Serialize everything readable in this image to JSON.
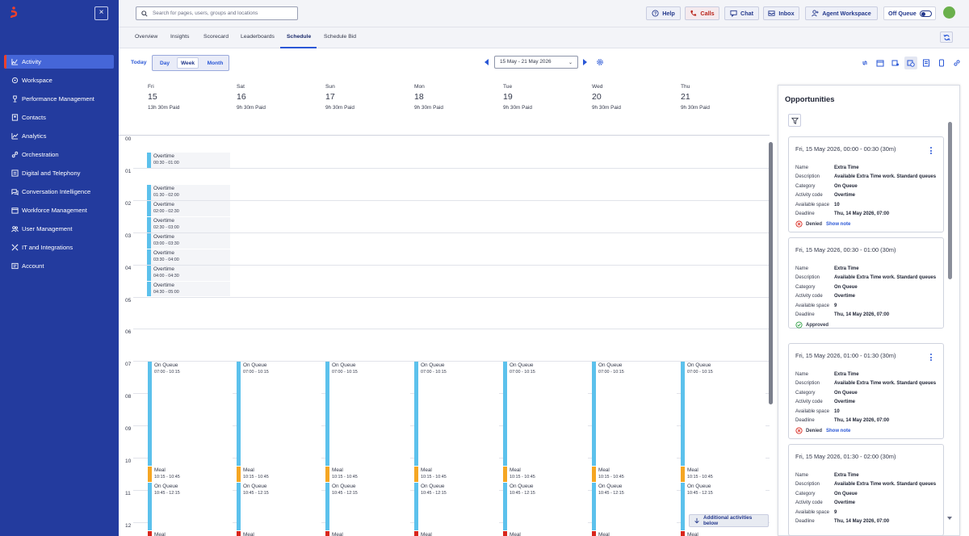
{
  "search": {
    "placeholder": "Search for pages, users, groups and locations"
  },
  "topbar": {
    "help": "Help",
    "calls": "Calls",
    "chat": "Chat",
    "inbox": "Inbox",
    "agent_workspace": "Agent Workspace",
    "off_queue": "Off Queue"
  },
  "sidebar": {
    "items": [
      {
        "label": "Activity",
        "icon": "activity-icon",
        "active": true
      },
      {
        "label": "Workspace",
        "icon": "workspace-icon"
      },
      {
        "label": "Performance Management",
        "icon": "trophy-icon"
      },
      {
        "label": "Contacts",
        "icon": "contacts-icon"
      },
      {
        "label": "Analytics",
        "icon": "analytics-icon"
      },
      {
        "label": "Orchestration",
        "icon": "orchestration-icon"
      },
      {
        "label": "Digital and Telephony",
        "icon": "phone-icon"
      },
      {
        "label": "Conversation Intelligence",
        "icon": "conversation-icon"
      },
      {
        "label": "Workforce Management",
        "icon": "workforce-icon"
      },
      {
        "label": "User Management",
        "icon": "users-icon"
      },
      {
        "label": "IT and Integrations",
        "icon": "tools-icon"
      },
      {
        "label": "Account",
        "icon": "account-icon"
      }
    ]
  },
  "tabs": [
    "Overview",
    "Insights",
    "Scorecard",
    "Leaderboards",
    "Schedule",
    "Schedule Bid"
  ],
  "active_tab": "Schedule",
  "toolbar": {
    "today": "Today",
    "views": [
      "Day",
      "Week",
      "Month"
    ],
    "active_view": "Week",
    "date_range": "15 May - 21 May 2026"
  },
  "days": [
    {
      "name": "Fri",
      "date": "15",
      "paid": "13h 30m Paid"
    },
    {
      "name": "Sat",
      "date": "16",
      "paid": "9h 30m Paid"
    },
    {
      "name": "Sun",
      "date": "17",
      "paid": "9h 30m Paid"
    },
    {
      "name": "Mon",
      "date": "18",
      "paid": "9h 30m Paid"
    },
    {
      "name": "Tue",
      "date": "19",
      "paid": "9h 30m Paid"
    },
    {
      "name": "Wed",
      "date": "20",
      "paid": "9h 30m Paid"
    },
    {
      "name": "Thu",
      "date": "21",
      "paid": "9h 30m Paid"
    }
  ],
  "hours": [
    "00",
    "01",
    "02",
    "03",
    "04",
    "05",
    "06",
    "07",
    "08",
    "09",
    "10",
    "11",
    "12"
  ],
  "overtime": [
    {
      "label": "Overtime",
      "time": "00:30 - 01:00"
    },
    {
      "label": "Overtime",
      "time": "01:30 - 02:00"
    },
    {
      "label": "Overtime",
      "time": "02:00 - 02:30"
    },
    {
      "label": "Overtime",
      "time": "02:30 - 03:00"
    },
    {
      "label": "Overtime",
      "time": "03:00 - 03:30"
    },
    {
      "label": "Overtime",
      "time": "03:30 - 04:00"
    },
    {
      "label": "Overtime",
      "time": "04:00 - 04:30"
    },
    {
      "label": "Overtime",
      "time": "04:30 - 05:00"
    }
  ],
  "daily_activities": [
    {
      "label": "On Queue",
      "time": "07:00 - 10:15",
      "kind": "queue"
    },
    {
      "label": "Meal",
      "time": "10:15 - 10:45",
      "kind": "meal"
    },
    {
      "label": "On Queue",
      "time": "10:45 - 12:15",
      "kind": "queue"
    },
    {
      "label": "Meal",
      "time": "",
      "kind": "break"
    }
  ],
  "additional_activities": "Additional activities below",
  "opportunities": {
    "title": "Opportunities",
    "cards": [
      {
        "title": "Fri, 15 May 2026, 00:00 - 00:30 (30m)",
        "name": "Extra Time",
        "description": "Available Extra Time work. Standard queues",
        "category": "On Queue",
        "activity_code": "Overtime",
        "available_space": "10",
        "deadline": "Thu, 14 May 2026, 07:00",
        "status": "Denied",
        "note": "Show note",
        "menu": true
      },
      {
        "title": "Fri, 15 May 2026, 00:30 - 01:00 (30m)",
        "name": "Extra Time",
        "description": "Available Extra Time work. Standard queues",
        "category": "On Queue",
        "activity_code": "Overtime",
        "available_space": "9",
        "deadline": "Thu, 14 May 2026, 07:00",
        "status": "Approved",
        "note": "",
        "menu": false
      },
      {
        "title": "Fri, 15 May 2026, 01:00 - 01:30 (30m)",
        "name": "Extra Time",
        "description": "Available Extra Time work. Standard queues",
        "category": "On Queue",
        "activity_code": "Overtime",
        "available_space": "10",
        "deadline": "Thu, 14 May 2026, 07:00",
        "status": "Denied",
        "note": "Show note",
        "menu": true
      },
      {
        "title": "Fri, 15 May 2026, 01:30 - 02:00 (30m)",
        "name": "Extra Time",
        "description": "Available Extra Time work. Standard queues",
        "category": "On Queue",
        "activity_code": "Overtime",
        "available_space": "9",
        "deadline": "Thu, 14 May 2026, 07:00",
        "status": "",
        "note": "",
        "menu": false
      }
    ],
    "labels": {
      "name": "Name",
      "description": "Description",
      "category": "Category",
      "activity_code": "Activity code",
      "available_space": "Available space",
      "deadline": "Deadline"
    }
  },
  "colors": {
    "sidebar": "#233b9e",
    "accent": "#2a57d6",
    "on_queue": "#5cc1ec",
    "meal": "#f5a623",
    "break": "#d9261c",
    "denied": "#d9261c",
    "approved": "#2e9e44"
  }
}
